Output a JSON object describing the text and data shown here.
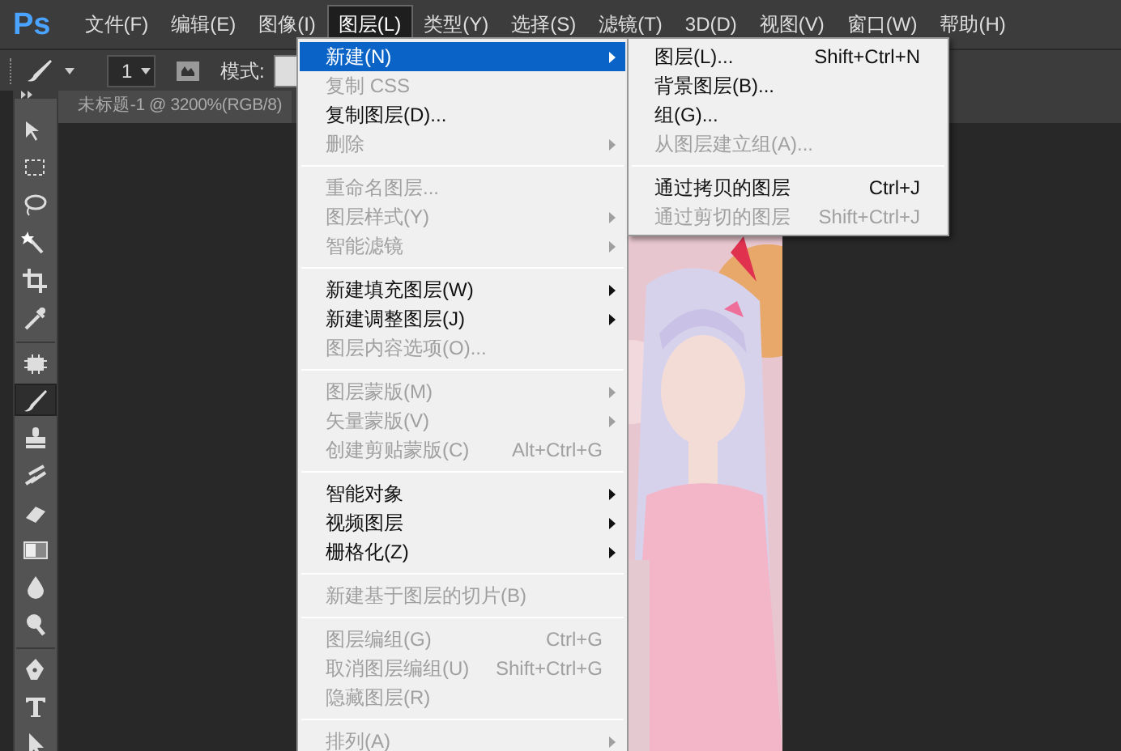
{
  "app_logo": "Ps",
  "menu_bar": [
    {
      "label": "文件(F)",
      "selected": false
    },
    {
      "label": "编辑(E)",
      "selected": false
    },
    {
      "label": "图像(I)",
      "selected": false
    },
    {
      "label": "图层(L)",
      "selected": true
    },
    {
      "label": "类型(Y)",
      "selected": false
    },
    {
      "label": "选择(S)",
      "selected": false
    },
    {
      "label": "滤镜(T)",
      "selected": false
    },
    {
      "label": "3D(D)",
      "selected": false
    },
    {
      "label": "视图(V)",
      "selected": false
    },
    {
      "label": "窗口(W)",
      "selected": false
    },
    {
      "label": "帮助(H)",
      "selected": false
    }
  ],
  "options_bar": {
    "brush_size": "1",
    "mode_label": "模式:"
  },
  "document_tab": {
    "title": "未标题-1 @ 3200%(RGB/8)"
  },
  "tools": [
    {
      "selected": false
    },
    {
      "selected": false
    },
    {
      "selected": false
    },
    {
      "selected": false
    },
    {
      "selected": false
    },
    {
      "selected": false
    },
    {
      "selected": false
    },
    {
      "selected": true
    },
    {
      "selected": false
    },
    {
      "selected": false
    },
    {
      "selected": false
    },
    {
      "selected": false
    },
    {
      "selected": false
    },
    {
      "selected": false
    },
    {
      "selected": false
    },
    {
      "selected": false
    },
    {
      "selected": false
    }
  ],
  "layer_menu": [
    {
      "kind": "item",
      "label": "新建(N)",
      "disabled": false,
      "submenu": true,
      "selected": true
    },
    {
      "kind": "item",
      "label": "复制 CSS",
      "disabled": true,
      "submenu": false,
      "selected": false
    },
    {
      "kind": "item",
      "label": "复制图层(D)...",
      "disabled": false,
      "submenu": false,
      "selected": false
    },
    {
      "kind": "item",
      "label": "删除",
      "disabled": true,
      "submenu": true,
      "selected": false
    },
    {
      "kind": "separator"
    },
    {
      "kind": "item",
      "label": "重命名图层...",
      "disabled": true,
      "submenu": false,
      "selected": false
    },
    {
      "kind": "item",
      "label": "图层样式(Y)",
      "disabled": true,
      "submenu": true,
      "selected": false
    },
    {
      "kind": "item",
      "label": "智能滤镜",
      "disabled": true,
      "submenu": true,
      "selected": false
    },
    {
      "kind": "separator"
    },
    {
      "kind": "item",
      "label": "新建填充图层(W)",
      "disabled": false,
      "submenu": true,
      "selected": false
    },
    {
      "kind": "item",
      "label": "新建调整图层(J)",
      "disabled": false,
      "submenu": true,
      "selected": false
    },
    {
      "kind": "item",
      "label": "图层内容选项(O)...",
      "disabled": true,
      "submenu": false,
      "selected": false
    },
    {
      "kind": "separator"
    },
    {
      "kind": "item",
      "label": "图层蒙版(M)",
      "disabled": true,
      "submenu": true,
      "selected": false
    },
    {
      "kind": "item",
      "label": "矢量蒙版(V)",
      "disabled": true,
      "submenu": true,
      "selected": false
    },
    {
      "kind": "item",
      "label": "创建剪贴蒙版(C)",
      "shortcut": "Alt+Ctrl+G",
      "disabled": true,
      "submenu": false,
      "selected": false
    },
    {
      "kind": "separator"
    },
    {
      "kind": "item",
      "label": "智能对象",
      "disabled": false,
      "submenu": true,
      "selected": false
    },
    {
      "kind": "item",
      "label": "视频图层",
      "disabled": false,
      "submenu": true,
      "selected": false
    },
    {
      "kind": "item",
      "label": "栅格化(Z)",
      "disabled": false,
      "submenu": true,
      "selected": false
    },
    {
      "kind": "separator"
    },
    {
      "kind": "item",
      "label": "新建基于图层的切片(B)",
      "disabled": true,
      "submenu": false,
      "selected": false
    },
    {
      "kind": "separator"
    },
    {
      "kind": "item",
      "label": "图层编组(G)",
      "shortcut": "Ctrl+G",
      "disabled": true,
      "submenu": false,
      "selected": false
    },
    {
      "kind": "item",
      "label": "取消图层编组(U)",
      "shortcut": "Shift+Ctrl+G",
      "disabled": true,
      "submenu": false,
      "selected": false
    },
    {
      "kind": "item",
      "label": "隐藏图层(R)",
      "disabled": true,
      "submenu": false,
      "selected": false
    },
    {
      "kind": "separator"
    },
    {
      "kind": "item",
      "label": "排列(A)",
      "disabled": true,
      "submenu": true,
      "selected": false
    }
  ],
  "new_submenu": [
    {
      "kind": "item",
      "label": "图层(L)...",
      "shortcut": "Shift+Ctrl+N",
      "disabled": false
    },
    {
      "kind": "item",
      "label": "背景图层(B)...",
      "disabled": false
    },
    {
      "kind": "item",
      "label": "组(G)...",
      "disabled": false
    },
    {
      "kind": "item",
      "label": "从图层建立组(A)...",
      "disabled": true
    },
    {
      "kind": "separator"
    },
    {
      "kind": "item",
      "label": "通过拷贝的图层",
      "shortcut": "Ctrl+J",
      "disabled": false
    },
    {
      "kind": "item",
      "label": "通过剪切的图层",
      "shortcut": "Shift+Ctrl+J",
      "disabled": true
    }
  ]
}
